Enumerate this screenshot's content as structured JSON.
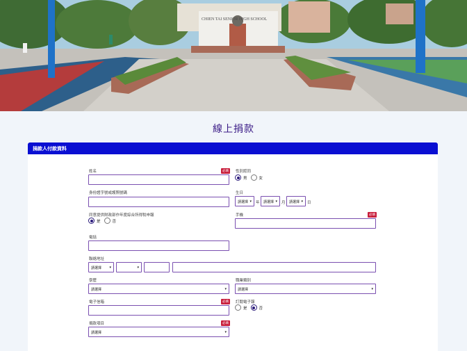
{
  "page": {
    "title": "線上捐款",
    "hero_sign": "CHIEN TAI SENIOR HIGH SCHOOL"
  },
  "section": {
    "title": "捐款人付款資料"
  },
  "required_badge": "必填",
  "fields": {
    "name": {
      "label": "姓名",
      "value": ""
    },
    "gender": {
      "label": "性別認同",
      "options": [
        "男",
        "女"
      ],
      "selected": "男"
    },
    "id_number": {
      "label": "身份證字號或護照號碼",
      "value": ""
    },
    "birthday": {
      "label": "生日",
      "year": {
        "value": "請選擇",
        "unit": "年"
      },
      "month": {
        "value": "請選擇",
        "unit": "月"
      },
      "day": {
        "value": "請選擇",
        "unit": "日"
      }
    },
    "tax_consent": {
      "label": "同意提供財政部作年度綜合所得稅申報",
      "options": [
        "是",
        "否"
      ],
      "selected": "是"
    },
    "mobile": {
      "label": "手機",
      "value": ""
    },
    "phone": {
      "label": "電話",
      "value": ""
    },
    "address": {
      "label": "聯絡地址",
      "city": "請選擇",
      "district": "",
      "zip": "",
      "street": ""
    },
    "education": {
      "label": "學歷",
      "value": "請選擇"
    },
    "occupation": {
      "label": "職業類別",
      "value": "請選擇"
    },
    "email": {
      "label": "電子信箱",
      "value": ""
    },
    "newsletter": {
      "label": "訂閱電子報",
      "options": [
        "是",
        "否"
      ],
      "selected": "否"
    },
    "donation_item": {
      "label": "捐款項目",
      "value": "請選擇"
    }
  },
  "colors": {
    "header_bar": "#0a0fd2",
    "title_text": "#3a1a86",
    "required_badge": "#c81e3c",
    "input_border": "#7a4fb0"
  }
}
